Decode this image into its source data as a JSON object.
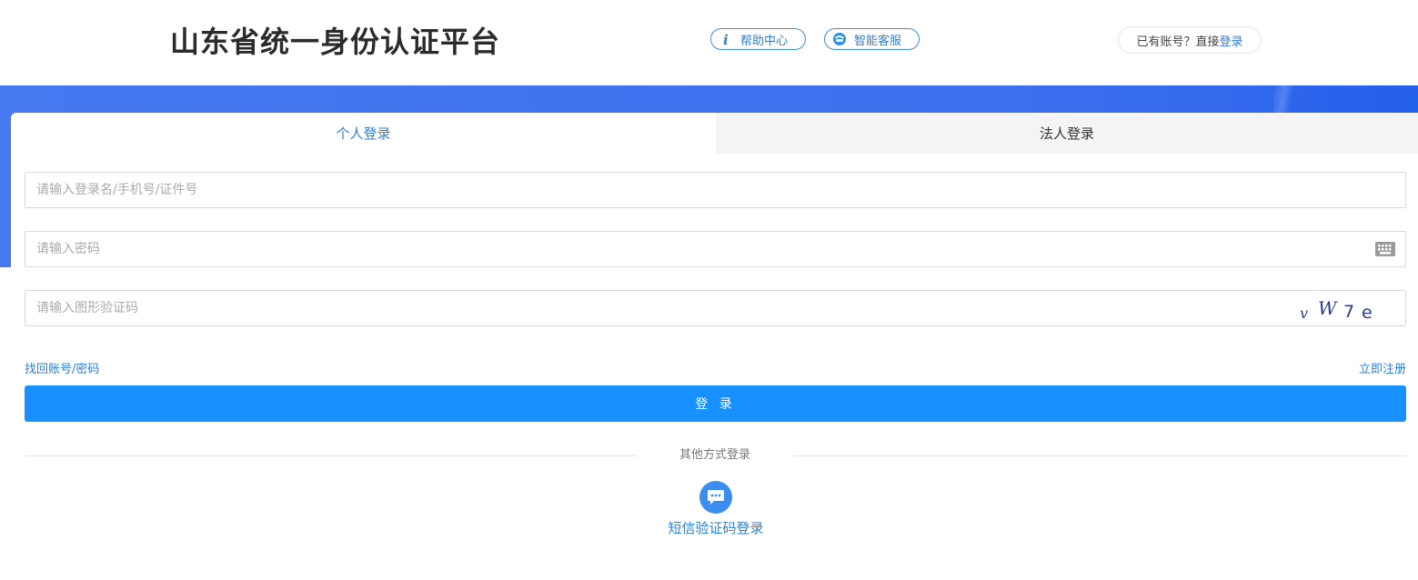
{
  "header": {
    "title": "山东省统一身份认证平台",
    "help_label": "帮助中心",
    "service_label": "智能客服",
    "account_prompt": "已有账号？直接",
    "account_login_link": "登录"
  },
  "tabs": [
    {
      "label": "个人登录",
      "active": true
    },
    {
      "label": "法人登录",
      "active": false
    }
  ],
  "form": {
    "username_placeholder": "请输入登录名/手机号/证件号",
    "password_placeholder": "请输入密码",
    "captcha_placeholder": "请输入图形验证码",
    "captcha_text": "vW7e",
    "forgot_link": "找回账号/密码",
    "register_link": "立即注册",
    "login_button": "登 录"
  },
  "other_login": {
    "divider_text": "其他方式登录",
    "sms_label": "短信验证码登录"
  },
  "colors": {
    "accent": "#1890ff",
    "link": "#2f7fd6",
    "banner": "#3c70ee"
  },
  "icons": {
    "help": "info-icon",
    "service": "chat-bot-icon",
    "keyboard": "keyboard-icon",
    "sms": "message-bubble-icon"
  }
}
